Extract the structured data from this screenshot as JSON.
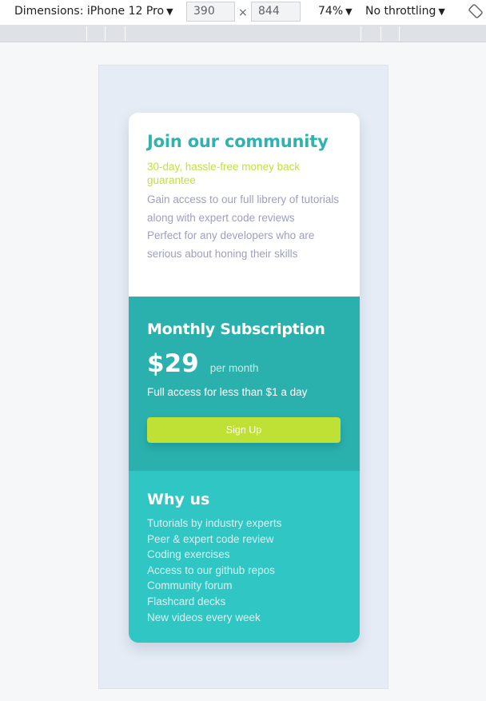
{
  "devtools": {
    "device_label": "Dimensions: iPhone 12 Pro",
    "width_value": "390",
    "height_value": "844",
    "times_symbol": "×",
    "zoom_label": "74%",
    "throttle_label": "No throttling",
    "dropdown_arrow": "▼",
    "rotate_icon": "rotate-icon"
  },
  "card": {
    "join": {
      "title": "Join our community",
      "guarantee": "30-day, hassle-free money back guarantee",
      "description_1": "Gain access to our full librery of tutorials along with expert code reviews",
      "description_2": "Perfect for any developers who are serious about honing their skills"
    },
    "subscription": {
      "title": "Monthly Subscription",
      "price": "$29",
      "per_period": "per month",
      "note": "Full access for less than $1 a day",
      "button_label": "Sign Up"
    },
    "why": {
      "title": "Why us",
      "items": [
        "Tutorials by industry experts",
        "Peer & expert code review",
        "Coding exercises",
        "Access to our github repos",
        "Community forum",
        "Flashcard decks",
        "New videos every week"
      ]
    }
  },
  "colors": {
    "accent_teal": "#2eb3b0",
    "mid_teal": "#2ab1ae",
    "light_teal": "#30c6c3",
    "lime": "#bfe035",
    "muted_text": "#9e9fbf"
  }
}
